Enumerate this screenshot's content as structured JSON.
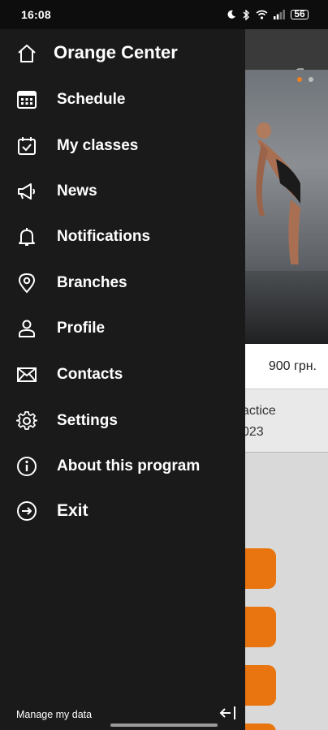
{
  "status_bar": {
    "time": "16:08",
    "battery": "56",
    "icons": [
      "moon-icon",
      "bluetooth-icon",
      "wifi-icon",
      "signal-icon",
      "battery-icon"
    ]
  },
  "drawer": {
    "title": "Orange Center",
    "items": [
      {
        "label": "Schedule",
        "icon": "calendar-grid-icon"
      },
      {
        "label": "My classes",
        "icon": "calendar-check-icon"
      },
      {
        "label": "News",
        "icon": "megaphone-icon"
      },
      {
        "label": "Notifications",
        "icon": "bell-icon"
      },
      {
        "label": "Branches",
        "icon": "map-pin-icon"
      },
      {
        "label": "Profile",
        "icon": "person-icon"
      },
      {
        "label": "Contacts",
        "icon": "envelope-icon"
      },
      {
        "label": "Settings",
        "icon": "gear-icon"
      },
      {
        "label": "About this program",
        "icon": "info-icon"
      },
      {
        "label": "Exit",
        "icon": "exit-icon"
      }
    ],
    "footer_link": "Manage my data",
    "collapse_icon": "collapse-left-icon"
  },
  "background": {
    "price": "900 грн.",
    "card_line1": "actice",
    "card_line2": "023"
  },
  "colors": {
    "accent": "#e8750f",
    "drawer_bg": "#1a1a1a",
    "text": "#ffffff"
  }
}
